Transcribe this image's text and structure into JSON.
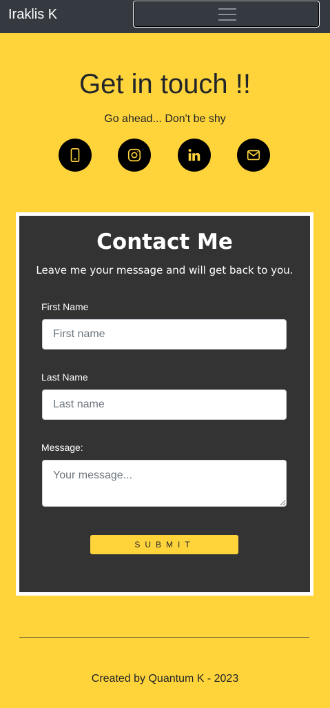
{
  "navbar": {
    "brand": "Iraklis K",
    "toggler_icon": "hamburger-icon"
  },
  "hero": {
    "title": "Get in touch !!",
    "subtitle": "Go ahead... Don't be shy"
  },
  "socials": [
    {
      "icon": "phone-icon"
    },
    {
      "icon": "instagram-icon"
    },
    {
      "icon": "linkedin-icon"
    },
    {
      "icon": "email-icon"
    }
  ],
  "contact": {
    "title": "Contact Me",
    "subtitle": "Leave me your message and will get back to you.",
    "first_name_label": "First Name",
    "first_name_placeholder": "First name",
    "first_name_value": "",
    "last_name_label": "Last Name",
    "last_name_placeholder": "Last name",
    "last_name_value": "",
    "message_label": "Message:",
    "message_placeholder": "Your message...",
    "message_value": "",
    "submit_label": "SUBMIT"
  },
  "footer": {
    "text": "Created by Quantum K - 2023"
  },
  "colors": {
    "background": "#ffd43b",
    "navbar": "#343a40",
    "card": "#333333",
    "icon_accent": "#ffd43b"
  }
}
